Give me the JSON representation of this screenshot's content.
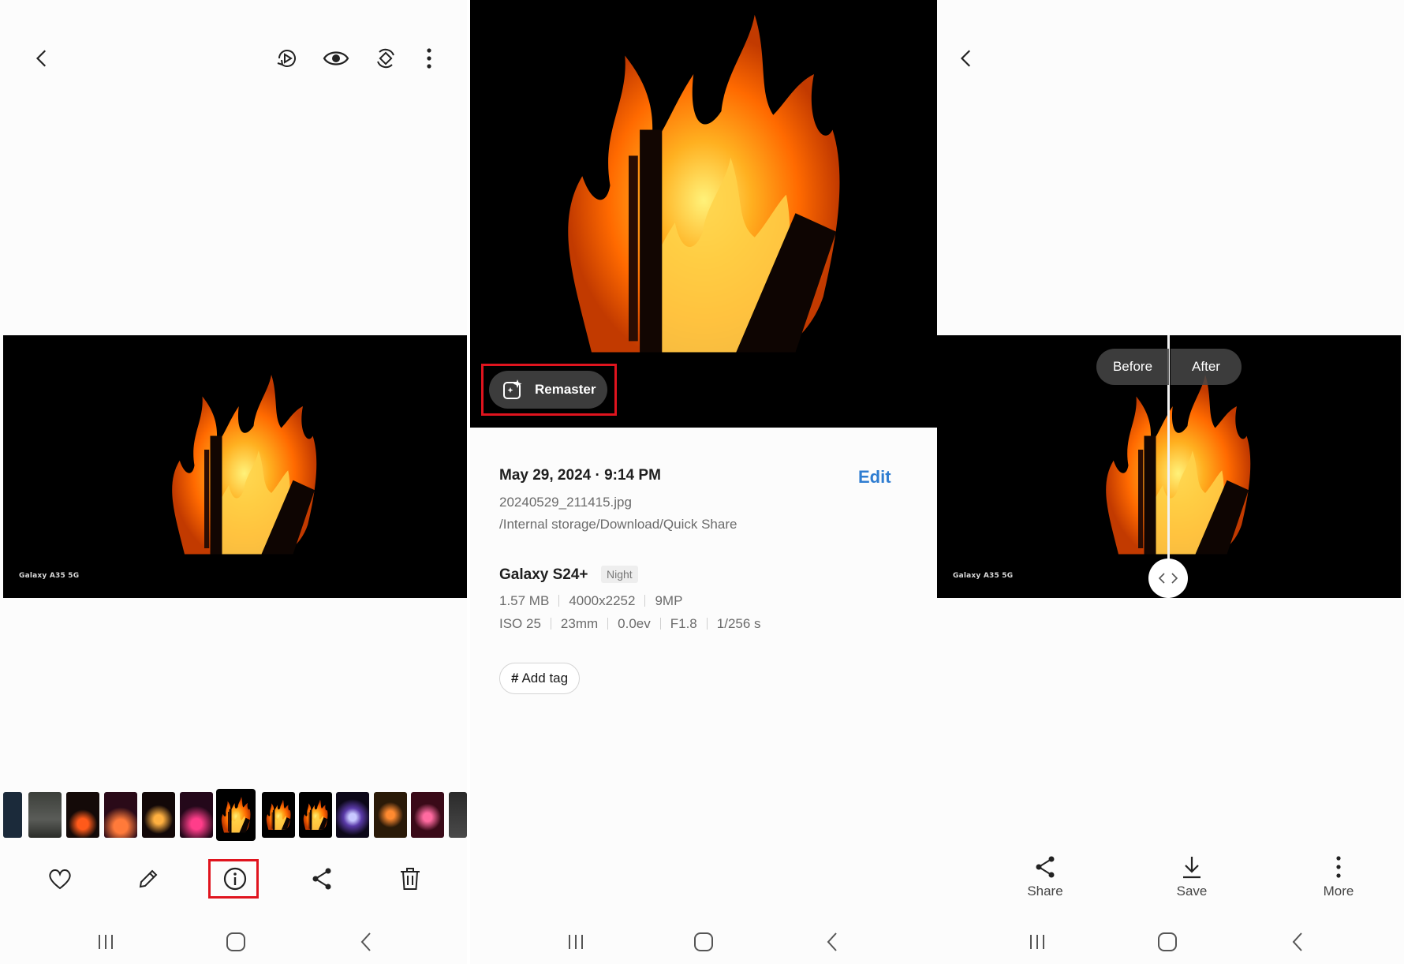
{
  "colors": {
    "accent": "#2f7dd1",
    "highlight": "#e0141e"
  },
  "panel1": {
    "photo_watermark": "Galaxy A35 5G",
    "toolbar_icons": [
      "back-icon",
      "play-motion-icon",
      "eye-icon",
      "rotate-icon",
      "more-vert-icon"
    ],
    "bottom_icons": [
      "heart-icon",
      "pencil-icon",
      "info-icon",
      "share-icon",
      "trash-icon"
    ]
  },
  "panel2": {
    "remaster_label": "Remaster",
    "date_time": "May 29, 2024 · 9:14 PM",
    "edit_label": "Edit",
    "filename": "20240529_211415.jpg",
    "path": "/Internal storage/Download/Quick Share",
    "device": "Galaxy S24+",
    "mode_badge": "Night",
    "specs_row1": [
      "1.57 MB",
      "4000x2252",
      "9MP"
    ],
    "specs_row2": [
      "ISO 25",
      "23mm",
      "0.0ev",
      "F1.8",
      "1/256 s"
    ],
    "add_tag_label": "Add tag",
    "hash_symbol": "#"
  },
  "panel3": {
    "before_label": "Before",
    "after_label": "After",
    "photo_watermark": "Galaxy A35 5G",
    "actions": [
      {
        "label": "Share",
        "icon": "share-icon"
      },
      {
        "label": "Save",
        "icon": "download-icon"
      },
      {
        "label": "More",
        "icon": "more-vert-icon"
      }
    ]
  }
}
